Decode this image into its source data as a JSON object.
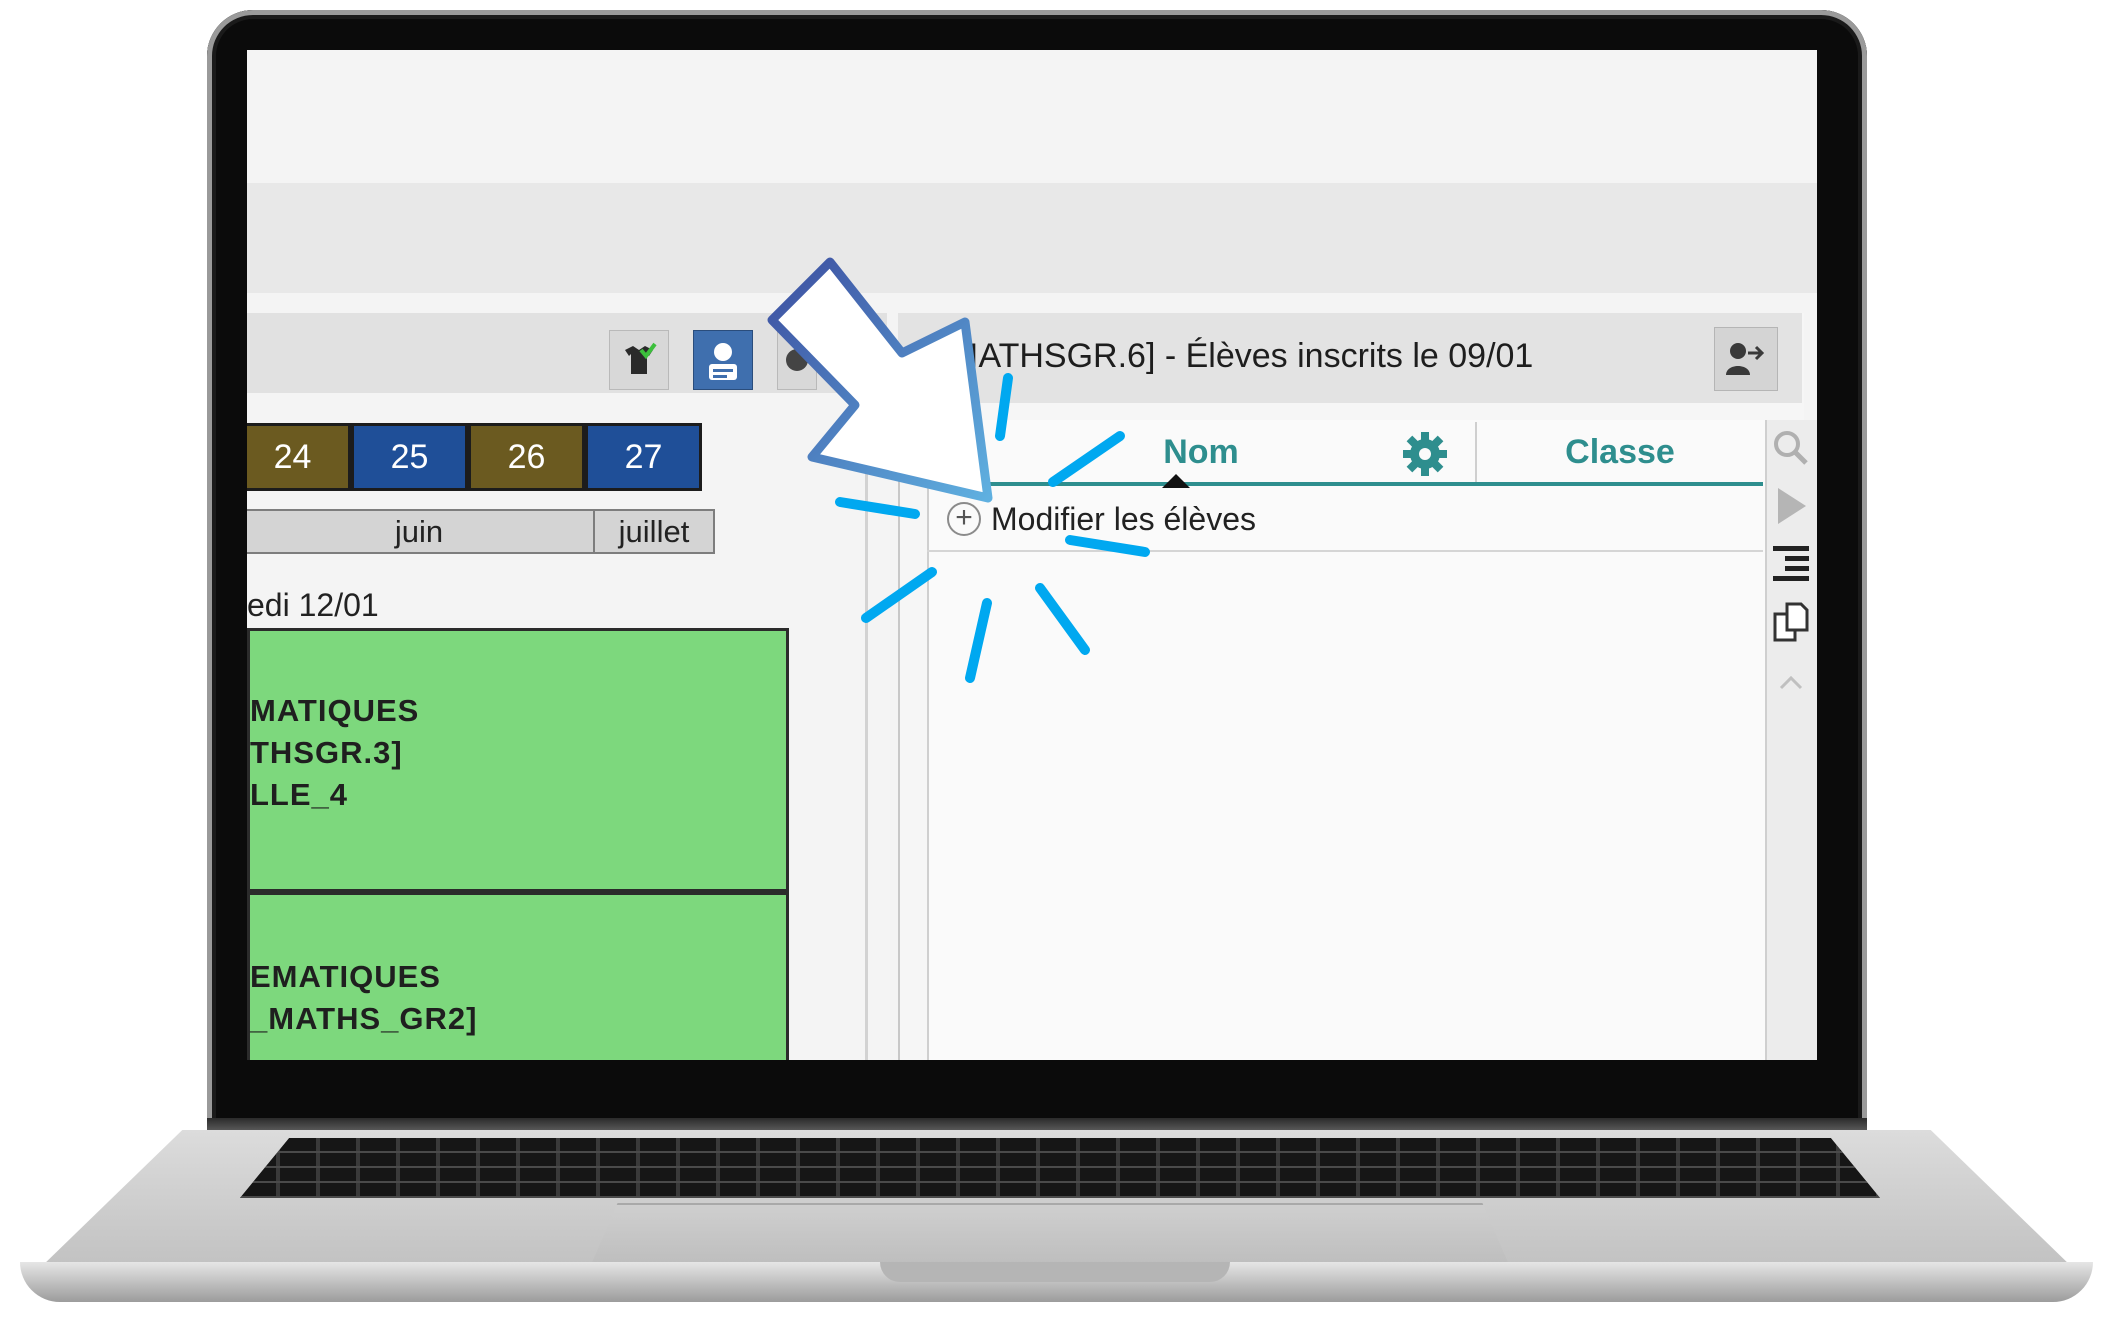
{
  "toolbar": {
    "icons": [
      "shirt-check-icon",
      "student-card-icon",
      "settings-icon"
    ]
  },
  "calendar": {
    "days": [
      {
        "label": "24",
        "color": "#6b5a20"
      },
      {
        "label": "25",
        "color": "#1f4f98"
      },
      {
        "label": "26",
        "color": "#6b5a20"
      },
      {
        "label": "27",
        "color": "#1f4f98"
      }
    ],
    "months": [
      "juin",
      "juillet"
    ],
    "date_label": "edi 12/01"
  },
  "courses": [
    {
      "lines": [
        "MATIQUES",
        "THSGR.3]",
        "LLE_4"
      ]
    },
    {
      "lines": [
        "EMATIQUES",
        "_MATHS_GR2]"
      ]
    }
  ],
  "panel": {
    "title": "IATHSGR.6] - Élèves inscrits le 09/01",
    "columns": {
      "nom": "Nom",
      "classe": "Classe"
    },
    "add_label": "Modifier les élèves",
    "add_symbol": "+"
  },
  "colors": {
    "accent": "#2e8e8e",
    "course_green": "#7dd87d",
    "active_button": "#3f6fae",
    "cursor_outline": "#4a6fb5",
    "spark": "#00a8f0"
  },
  "rail_icons": [
    "search-icon",
    "play-icon",
    "list-indent-icon",
    "copy-icon",
    "chevron-up-icon"
  ]
}
